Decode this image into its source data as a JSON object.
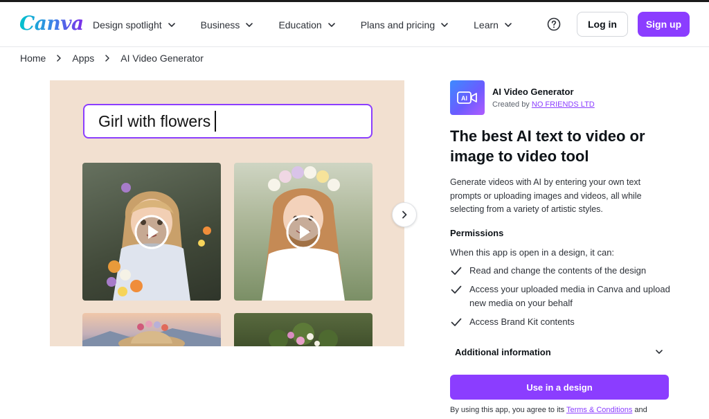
{
  "header": {
    "logo": "Canva",
    "nav": [
      {
        "label": "Design spotlight"
      },
      {
        "label": "Business"
      },
      {
        "label": "Education"
      },
      {
        "label": "Plans and pricing"
      },
      {
        "label": "Learn"
      }
    ],
    "login_label": "Log in",
    "signup_label": "Sign up"
  },
  "breadcrumb": [
    "Home",
    "Apps",
    "AI Video Generator"
  ],
  "hero": {
    "prompt_text": "Girl with flowers"
  },
  "app": {
    "icon_text": "AI",
    "name": "AI Video Generator",
    "created_by_prefix": "Created by",
    "creator": "NO FRIENDS LTD",
    "title": "The best AI text to video or image to video tool",
    "description": "Generate videos with AI by entering your own text prompts or uploading images and videos, all while selecting from a variety of artistic styles.",
    "permissions_heading": "Permissions",
    "permissions_intro": "When this app is open in a design, it can:",
    "permissions": [
      "Read and change the contents of the design",
      "Access your uploaded media in Canva and upload new media on your behalf",
      "Access Brand Kit contents"
    ],
    "additional_info_label": "Additional information",
    "use_button_label": "Use in a design",
    "terms_prefix": "By using this app, you agree to its",
    "terms_link": "Terms & Conditions",
    "terms_suffix": "and"
  },
  "colors": {
    "brand_purple": "#8b3dff",
    "hero_background": "#f2e0d0"
  }
}
